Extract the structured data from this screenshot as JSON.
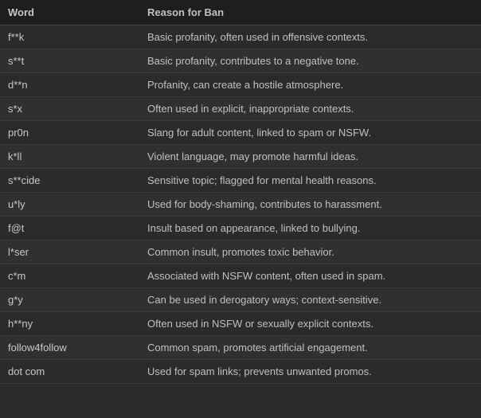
{
  "table": {
    "headers": {
      "word": "Word",
      "reason": "Reason for Ban"
    },
    "rows": [
      {
        "word": "f**k",
        "reason": "Basic profanity, often used in offensive contexts."
      },
      {
        "word": "s**t",
        "reason": "Basic profanity, contributes to a negative tone."
      },
      {
        "word": "d**n",
        "reason": "Profanity, can create a hostile atmosphere."
      },
      {
        "word": "s*x",
        "reason": "Often used in explicit, inappropriate contexts."
      },
      {
        "word": "pr0n",
        "reason": "Slang for adult content, linked to spam or NSFW."
      },
      {
        "word": "k*ll",
        "reason": "Violent language, may promote harmful ideas."
      },
      {
        "word": "s**cide",
        "reason": "Sensitive topic; flagged for mental health reasons."
      },
      {
        "word": "u*ly",
        "reason": "Used for body-shaming, contributes to harassment."
      },
      {
        "word": "f@t",
        "reason": "Insult based on appearance, linked to bullying."
      },
      {
        "word": "l*ser",
        "reason": "Common insult, promotes toxic behavior."
      },
      {
        "word": "c*m",
        "reason": "Associated with NSFW content, often used in spam."
      },
      {
        "word": "g*y",
        "reason": "Can be used in derogatory ways; context-sensitive."
      },
      {
        "word": "h**ny",
        "reason": "Often used in NSFW or sexually explicit contexts."
      },
      {
        "word": "follow4follow",
        "reason": "Common spam, promotes artificial engagement."
      },
      {
        "word": "dot com",
        "reason": "Used for spam links; prevents unwanted promos."
      }
    ]
  }
}
